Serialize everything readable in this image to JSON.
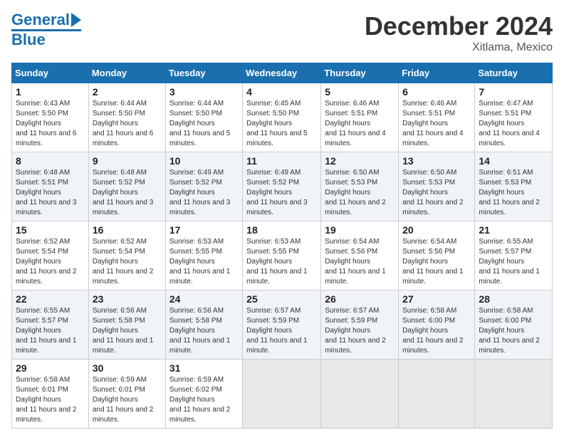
{
  "header": {
    "logo_line1": "General",
    "logo_line2": "Blue",
    "month": "December 2024",
    "location": "Xitlama, Mexico"
  },
  "calendar": {
    "days_of_week": [
      "Sunday",
      "Monday",
      "Tuesday",
      "Wednesday",
      "Thursday",
      "Friday",
      "Saturday"
    ],
    "weeks": [
      [
        null,
        {
          "day": 2,
          "sunrise": "6:44 AM",
          "sunset": "5:50 PM",
          "daylight": "11 hours and 6 minutes."
        },
        {
          "day": 3,
          "sunrise": "6:44 AM",
          "sunset": "5:50 PM",
          "daylight": "11 hours and 5 minutes."
        },
        {
          "day": 4,
          "sunrise": "6:45 AM",
          "sunset": "5:50 PM",
          "daylight": "11 hours and 5 minutes."
        },
        {
          "day": 5,
          "sunrise": "6:46 AM",
          "sunset": "5:51 PM",
          "daylight": "11 hours and 4 minutes."
        },
        {
          "day": 6,
          "sunrise": "6:46 AM",
          "sunset": "5:51 PM",
          "daylight": "11 hours and 4 minutes."
        },
        {
          "day": 7,
          "sunrise": "6:47 AM",
          "sunset": "5:51 PM",
          "daylight": "11 hours and 4 minutes."
        }
      ],
      [
        {
          "day": 1,
          "sunrise": "6:43 AM",
          "sunset": "5:50 PM",
          "daylight": "11 hours and 6 minutes."
        },
        {
          "day": 2,
          "sunrise": "6:44 AM",
          "sunset": "5:50 PM",
          "daylight": "11 hours and 6 minutes."
        },
        {
          "day": 3,
          "sunrise": "6:44 AM",
          "sunset": "5:50 PM",
          "daylight": "11 hours and 5 minutes."
        },
        {
          "day": 4,
          "sunrise": "6:45 AM",
          "sunset": "5:50 PM",
          "daylight": "11 hours and 5 minutes."
        },
        {
          "day": 5,
          "sunrise": "6:46 AM",
          "sunset": "5:51 PM",
          "daylight": "11 hours and 4 minutes."
        },
        {
          "day": 6,
          "sunrise": "6:46 AM",
          "sunset": "5:51 PM",
          "daylight": "11 hours and 4 minutes."
        },
        {
          "day": 7,
          "sunrise": "6:47 AM",
          "sunset": "5:51 PM",
          "daylight": "11 hours and 4 minutes."
        }
      ],
      [
        {
          "day": 8,
          "sunrise": "6:48 AM",
          "sunset": "5:51 PM",
          "daylight": "11 hours and 3 minutes."
        },
        {
          "day": 9,
          "sunrise": "6:48 AM",
          "sunset": "5:52 PM",
          "daylight": "11 hours and 3 minutes."
        },
        {
          "day": 10,
          "sunrise": "6:49 AM",
          "sunset": "5:52 PM",
          "daylight": "11 hours and 3 minutes."
        },
        {
          "day": 11,
          "sunrise": "6:49 AM",
          "sunset": "5:52 PM",
          "daylight": "11 hours and 3 minutes."
        },
        {
          "day": 12,
          "sunrise": "6:50 AM",
          "sunset": "5:53 PM",
          "daylight": "11 hours and 2 minutes."
        },
        {
          "day": 13,
          "sunrise": "6:50 AM",
          "sunset": "5:53 PM",
          "daylight": "11 hours and 2 minutes."
        },
        {
          "day": 14,
          "sunrise": "6:51 AM",
          "sunset": "5:53 PM",
          "daylight": "11 hours and 2 minutes."
        }
      ],
      [
        {
          "day": 15,
          "sunrise": "6:52 AM",
          "sunset": "5:54 PM",
          "daylight": "11 hours and 2 minutes."
        },
        {
          "day": 16,
          "sunrise": "6:52 AM",
          "sunset": "5:54 PM",
          "daylight": "11 hours and 2 minutes."
        },
        {
          "day": 17,
          "sunrise": "6:53 AM",
          "sunset": "5:55 PM",
          "daylight": "11 hours and 1 minute."
        },
        {
          "day": 18,
          "sunrise": "6:53 AM",
          "sunset": "5:55 PM",
          "daylight": "11 hours and 1 minute."
        },
        {
          "day": 19,
          "sunrise": "6:54 AM",
          "sunset": "5:56 PM",
          "daylight": "11 hours and 1 minute."
        },
        {
          "day": 20,
          "sunrise": "6:54 AM",
          "sunset": "5:56 PM",
          "daylight": "11 hours and 1 minute."
        },
        {
          "day": 21,
          "sunrise": "6:55 AM",
          "sunset": "5:57 PM",
          "daylight": "11 hours and 1 minute."
        }
      ],
      [
        {
          "day": 22,
          "sunrise": "6:55 AM",
          "sunset": "5:57 PM",
          "daylight": "11 hours and 1 minute."
        },
        {
          "day": 23,
          "sunrise": "6:56 AM",
          "sunset": "5:58 PM",
          "daylight": "11 hours and 1 minute."
        },
        {
          "day": 24,
          "sunrise": "6:56 AM",
          "sunset": "5:58 PM",
          "daylight": "11 hours and 1 minute."
        },
        {
          "day": 25,
          "sunrise": "6:57 AM",
          "sunset": "5:59 PM",
          "daylight": "11 hours and 1 minute."
        },
        {
          "day": 26,
          "sunrise": "6:57 AM",
          "sunset": "5:59 PM",
          "daylight": "11 hours and 2 minutes."
        },
        {
          "day": 27,
          "sunrise": "6:58 AM",
          "sunset": "6:00 PM",
          "daylight": "11 hours and 2 minutes."
        },
        {
          "day": 28,
          "sunrise": "6:58 AM",
          "sunset": "6:00 PM",
          "daylight": "11 hours and 2 minutes."
        }
      ],
      [
        {
          "day": 29,
          "sunrise": "6:58 AM",
          "sunset": "6:01 PM",
          "daylight": "11 hours and 2 minutes."
        },
        {
          "day": 30,
          "sunrise": "6:59 AM",
          "sunset": "6:01 PM",
          "daylight": "11 hours and 2 minutes."
        },
        {
          "day": 31,
          "sunrise": "6:59 AM",
          "sunset": "6:02 PM",
          "daylight": "11 hours and 2 minutes."
        },
        null,
        null,
        null,
        null
      ]
    ]
  }
}
